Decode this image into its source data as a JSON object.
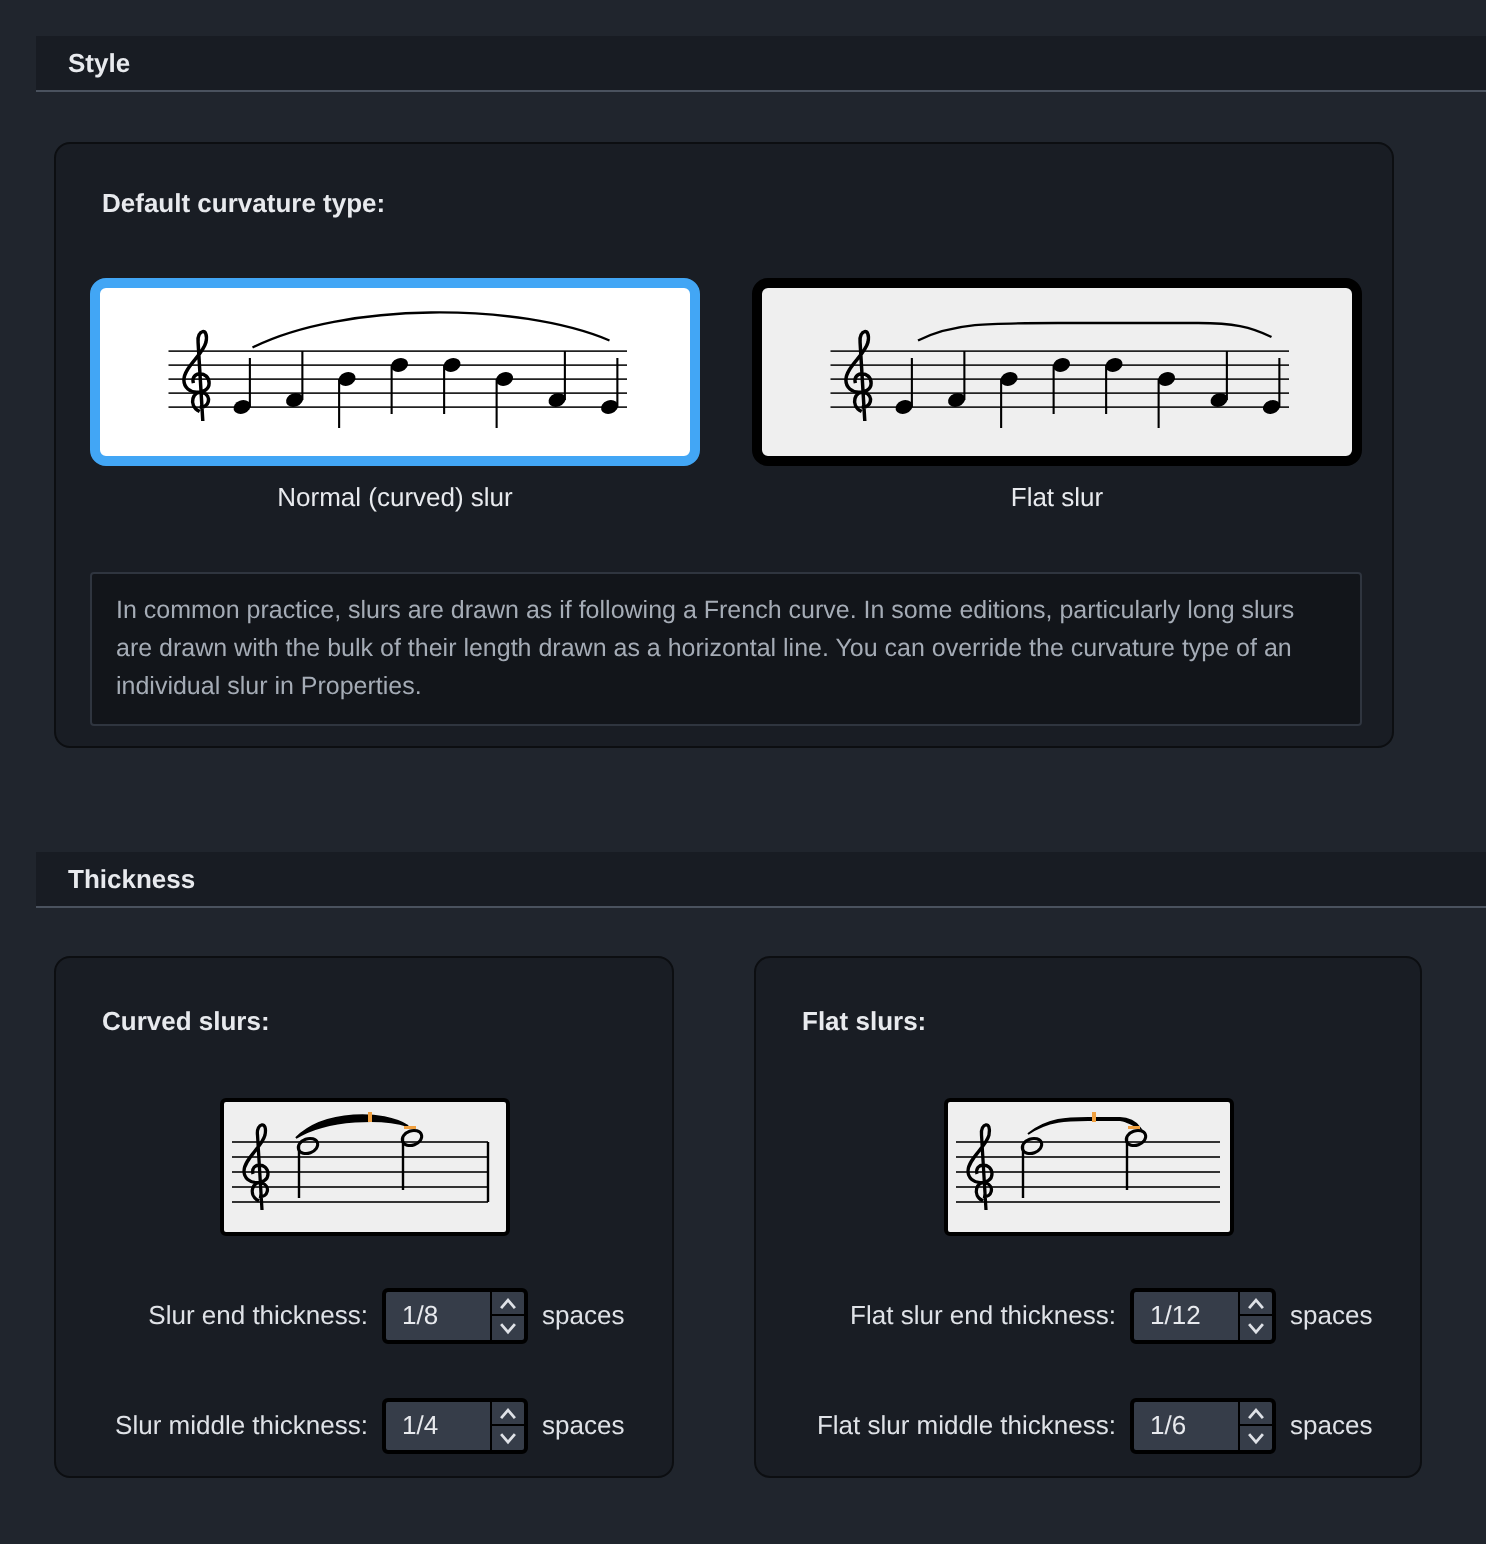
{
  "sections": [
    {
      "kind": "style",
      "title": "Style"
    },
    {
      "kind": "thickness",
      "title": "Thickness"
    }
  ],
  "curvature": {
    "label": "Default curvature type:",
    "options": [
      {
        "kind": "curved",
        "label": "Normal (curved) slur",
        "selected": true
      },
      {
        "kind": "flat",
        "label": "Flat slur",
        "selected": false
      }
    ],
    "description": "In common practice, slurs are drawn as if following a French curve. In some editions, particularly long slurs are drawn with the bulk of their length drawn as a horizontal line. You can override the curvature type of an individual slur in Properties."
  },
  "thickness": [
    {
      "kind": "curved",
      "title": "Curved slurs:",
      "fields": [
        {
          "label": "Slur end thickness:",
          "value": "1/8",
          "unit": "spaces"
        },
        {
          "label": "Slur middle thickness:",
          "value": "1/4",
          "unit": "spaces"
        }
      ]
    },
    {
      "kind": "flat",
      "title": "Flat slurs:",
      "fields": [
        {
          "label": "Flat slur end thickness:",
          "value": "1/12",
          "unit": "spaces"
        },
        {
          "label": "Flat slur middle thickness:",
          "value": "1/6",
          "unit": "spaces"
        }
      ]
    }
  ]
}
